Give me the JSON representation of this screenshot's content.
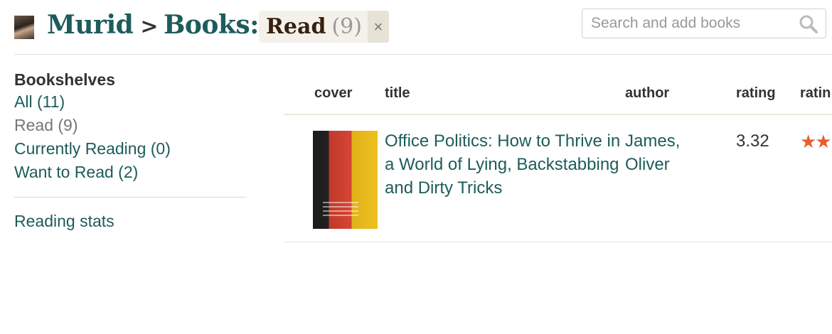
{
  "header": {
    "user": "Murid",
    "separator": ">",
    "books": "Books:",
    "shelf": "Read",
    "shelf_count": "(9)",
    "close_symbol": "×"
  },
  "search": {
    "placeholder": "Search and add books",
    "value": ""
  },
  "sidebar": {
    "heading": "Bookshelves",
    "shelves": [
      {
        "label": "All (11)",
        "selected": false
      },
      {
        "label": "Read (9)",
        "selected": true
      },
      {
        "label": "Currently Reading (0)",
        "selected": false
      },
      {
        "label": "Want to Read (2)",
        "selected": false
      }
    ],
    "stats_link": "Reading stats"
  },
  "table": {
    "columns": [
      "cover",
      "title",
      "author",
      "rating",
      "ratin"
    ],
    "rows": [
      {
        "title": "Office Politics: How to Thrive in a World of Lying, Backstabbing and Dirty Tricks",
        "author": "James, Oliver",
        "avg_rating": "3.32",
        "stars": "★★"
      }
    ]
  },
  "colors": {
    "link": "#1d5c5a",
    "star": "#e85d2f",
    "tag_bg": "#f4f1ea"
  },
  "icons": {
    "search": "magnifier-icon",
    "close": "close-icon"
  }
}
